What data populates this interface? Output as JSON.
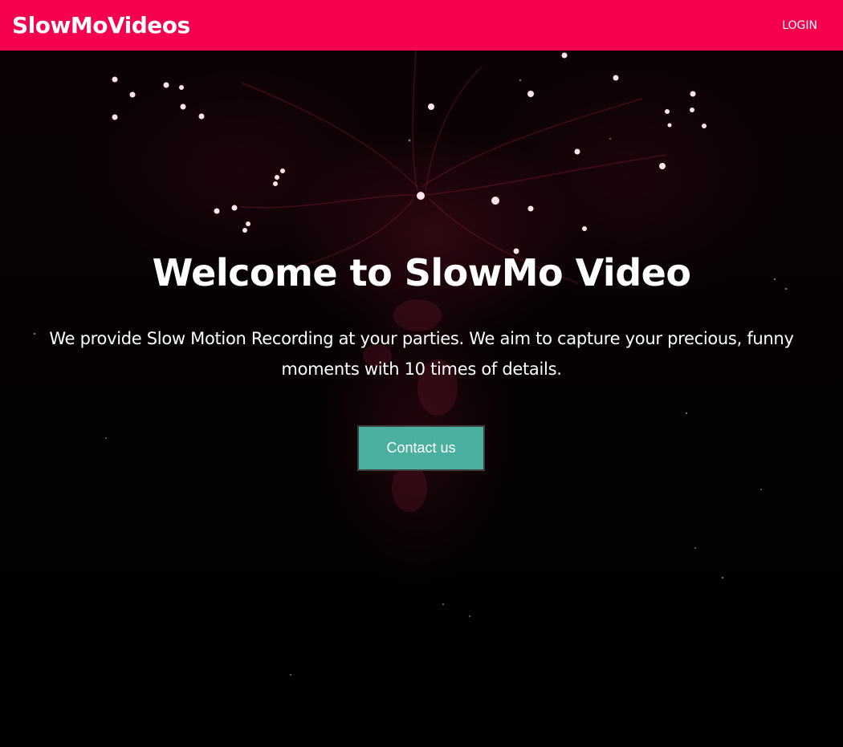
{
  "navbar": {
    "brand": "SlowMoVideos",
    "login_label": "LOGIN",
    "background_color": "#f5004f"
  },
  "hero": {
    "title": "Welcome to SlowMo Video",
    "description": "We provide Slow Motion Recording at your parties. We aim to capture your precious, funny moments with 10 times of details.",
    "contact_button_label": "Contact us",
    "button_color": "#4bb09f",
    "background_image": "fireworks-at-night-image"
  }
}
